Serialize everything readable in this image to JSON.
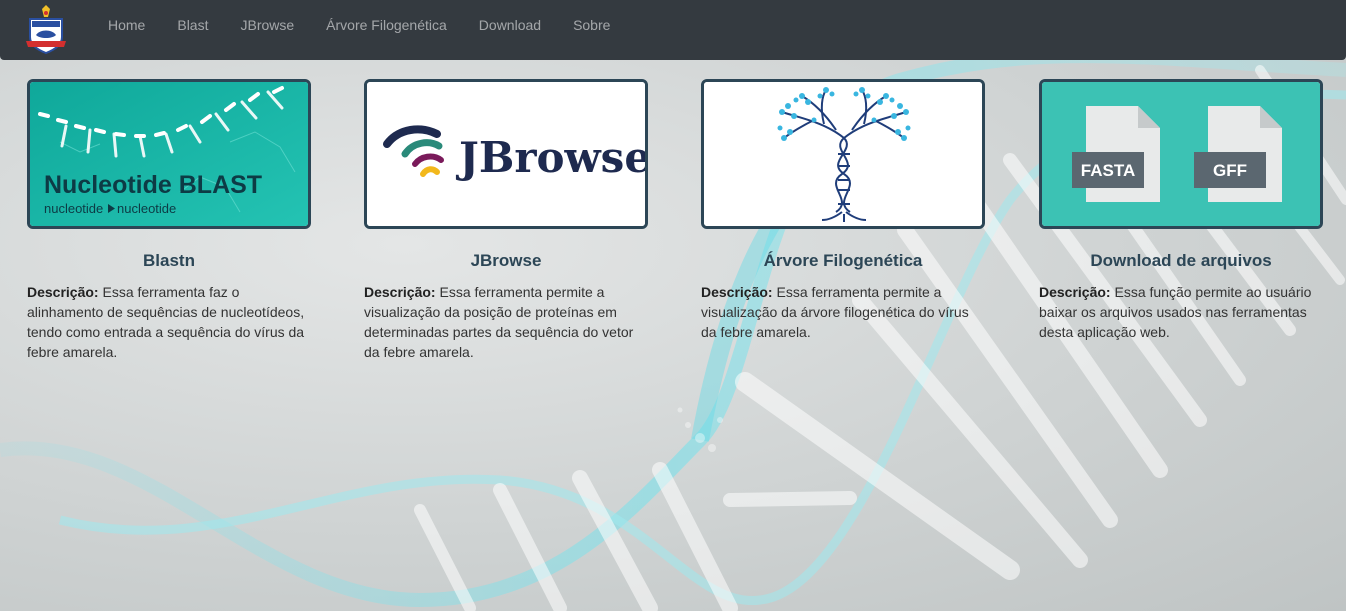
{
  "nav": {
    "logo_icon": "university-crest-icon",
    "links": [
      "Home",
      "Blast",
      "JBrowse",
      "Árvore Filogenética",
      "Download",
      "Sobre"
    ]
  },
  "cards": [
    {
      "title": "Blastn",
      "desc_label": "Descrição:",
      "desc_text": " Essa ferramenta faz o alinhamento de sequências de nucleotídeos, tendo como entrada a sequência do vírus da febre amarela.",
      "image": {
        "heading": "Nucleotide BLAST",
        "sub_left": "nucleotide",
        "sub_right": "nucleotide"
      }
    },
    {
      "title": "JBrowse",
      "desc_label": "Descrição:",
      "desc_text": " Essa ferramenta permite a visualização da posição de proteínas em determinadas partes da sequência do vetor da febre amarela.",
      "image": {
        "wordmark": "JBrowse"
      }
    },
    {
      "title": "Árvore Filogenética",
      "desc_label": "Descrição:",
      "desc_text": " Essa ferramenta permite a visualização da árvore filogenética do vírus da febre amarela.",
      "image": {
        "icon": "dna-tree-icon"
      }
    },
    {
      "title": "Download de arquivos",
      "desc_label": "Descrição:",
      "desc_text": " Essa função permite ao usuário baixar os arquivos usados nas ferramentas desta aplicação web.",
      "image": {
        "file1": "FASTA",
        "file2": "GFF"
      }
    }
  ],
  "colors": {
    "navbar": "#343a40",
    "card_border": "#2c4656",
    "title": "#2c4656",
    "blast_teal": "#1bb5a6",
    "download_teal": "#3cc2b4",
    "jbrowse_navy": "#1e2a4f"
  }
}
